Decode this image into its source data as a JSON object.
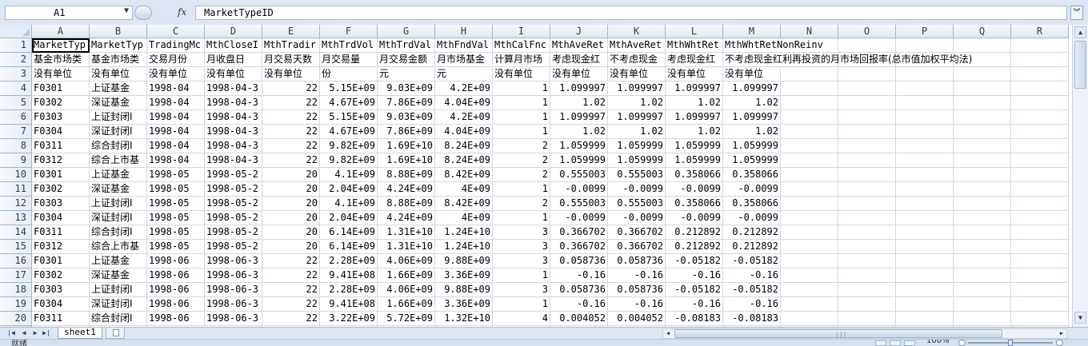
{
  "formula_bar": {
    "cell_ref": "A1",
    "fx_label": "fx",
    "formula": "MarketTypeID"
  },
  "columns": [
    "A",
    "B",
    "C",
    "D",
    "E",
    "F",
    "G",
    "H",
    "I",
    "J",
    "K",
    "L",
    "M",
    "N",
    "O",
    "P",
    "Q",
    "R"
  ],
  "rows": [
    [
      "MarketTyp",
      "MarketTyp",
      "TradingMc",
      "MthCloseI",
      "MthTradir",
      "MthTrdVol",
      "MthTrdVal",
      "MthFndVal",
      "MthCalFnc",
      "MthAveRet",
      "MthAveRet",
      "MthWhtRet",
      "MthWhtRetNonReinv"
    ],
    [
      "基金市场类",
      "基金市场类",
      "交易月份",
      "月收盘日",
      "月交易天数",
      "月交易量",
      "月交易金额",
      "月市场基金",
      "计算月市场",
      "考虑现金红",
      "不考虑现金",
      "考虑现金红",
      "不考虑现金红利再投资的月市场回报率(总市值加权平均法)"
    ],
    [
      "没有单位",
      "没有单位",
      "没有单位",
      "没有单位",
      "没有单位",
      "份",
      "元",
      "元",
      "没有单位",
      "没有单位",
      "没有单位",
      "没有单位",
      "没有单位"
    ],
    [
      "F0301",
      "上证基金",
      "1998-04",
      "1998-04-3",
      "22",
      "5.15E+09",
      "9.03E+09",
      "4.2E+09",
      "1",
      "1.099997",
      "1.099997",
      "1.099997",
      "1.099997"
    ],
    [
      "F0302",
      "深证基金",
      "1998-04",
      "1998-04-3",
      "22",
      "4.67E+09",
      "7.86E+09",
      "4.04E+09",
      "1",
      "1.02",
      "1.02",
      "1.02",
      "1.02"
    ],
    [
      "F0303",
      "上证封闭I",
      "1998-04",
      "1998-04-3",
      "22",
      "5.15E+09",
      "9.03E+09",
      "4.2E+09",
      "1",
      "1.099997",
      "1.099997",
      "1.099997",
      "1.099997"
    ],
    [
      "F0304",
      "深证封闭I",
      "1998-04",
      "1998-04-3",
      "22",
      "4.67E+09",
      "7.86E+09",
      "4.04E+09",
      "1",
      "1.02",
      "1.02",
      "1.02",
      "1.02"
    ],
    [
      "F0311",
      "综合封闭I",
      "1998-04",
      "1998-04-3",
      "22",
      "9.82E+09",
      "1.69E+10",
      "8.24E+09",
      "2",
      "1.059999",
      "1.059999",
      "1.059999",
      "1.059999"
    ],
    [
      "F0312",
      "综合上市基",
      "1998-04",
      "1998-04-3",
      "22",
      "9.82E+09",
      "1.69E+10",
      "8.24E+09",
      "2",
      "1.059999",
      "1.059999",
      "1.059999",
      "1.059999"
    ],
    [
      "F0301",
      "上证基金",
      "1998-05",
      "1998-05-2",
      "20",
      "4.1E+09",
      "8.88E+09",
      "8.42E+09",
      "2",
      "0.555003",
      "0.555003",
      "0.358066",
      "0.358066"
    ],
    [
      "F0302",
      "深证基金",
      "1998-05",
      "1998-05-2",
      "20",
      "2.04E+09",
      "4.24E+09",
      "4E+09",
      "1",
      "-0.0099",
      "-0.0099",
      "-0.0099",
      "-0.0099"
    ],
    [
      "F0303",
      "上证封闭I",
      "1998-05",
      "1998-05-2",
      "20",
      "4.1E+09",
      "8.88E+09",
      "8.42E+09",
      "2",
      "0.555003",
      "0.555003",
      "0.358066",
      "0.358066"
    ],
    [
      "F0304",
      "深证封闭I",
      "1998-05",
      "1998-05-2",
      "20",
      "2.04E+09",
      "4.24E+09",
      "4E+09",
      "1",
      "-0.0099",
      "-0.0099",
      "-0.0099",
      "-0.0099"
    ],
    [
      "F0311",
      "综合封闭I",
      "1998-05",
      "1998-05-2",
      "20",
      "6.14E+09",
      "1.31E+10",
      "1.24E+10",
      "3",
      "0.366702",
      "0.366702",
      "0.212892",
      "0.212892"
    ],
    [
      "F0312",
      "综合上市基",
      "1998-05",
      "1998-05-2",
      "20",
      "6.14E+09",
      "1.31E+10",
      "1.24E+10",
      "3",
      "0.366702",
      "0.366702",
      "0.212892",
      "0.212892"
    ],
    [
      "F0301",
      "上证基金",
      "1998-06",
      "1998-06-3",
      "22",
      "2.28E+09",
      "4.06E+09",
      "9.88E+09",
      "3",
      "0.058736",
      "0.058736",
      "-0.05182",
      "-0.05182"
    ],
    [
      "F0302",
      "深证基金",
      "1998-06",
      "1998-06-3",
      "22",
      "9.41E+08",
      "1.66E+09",
      "3.36E+09",
      "1",
      "-0.16",
      "-0.16",
      "-0.16",
      "-0.16"
    ],
    [
      "F0303",
      "上证封闭I",
      "1998-06",
      "1998-06-3",
      "22",
      "2.28E+09",
      "4.06E+09",
      "9.88E+09",
      "3",
      "0.058736",
      "0.058736",
      "-0.05182",
      "-0.05182"
    ],
    [
      "F0304",
      "深证封闭I",
      "1998-06",
      "1998-06-3",
      "22",
      "9.41E+08",
      "1.66E+09",
      "3.36E+09",
      "1",
      "-0.16",
      "-0.16",
      "-0.16",
      "-0.16"
    ],
    [
      "F0311",
      "综合封闭I",
      "1998-06",
      "1998-06-3",
      "22",
      "3.22E+09",
      "5.72E+09",
      "1.32E+10",
      "4",
      "0.004052",
      "0.004052",
      "-0.08183",
      "-0.08183"
    ]
  ],
  "sheet_tabs": [
    "sheet1"
  ],
  "status": {
    "ready_text": "就绪",
    "zoom": "100%"
  }
}
